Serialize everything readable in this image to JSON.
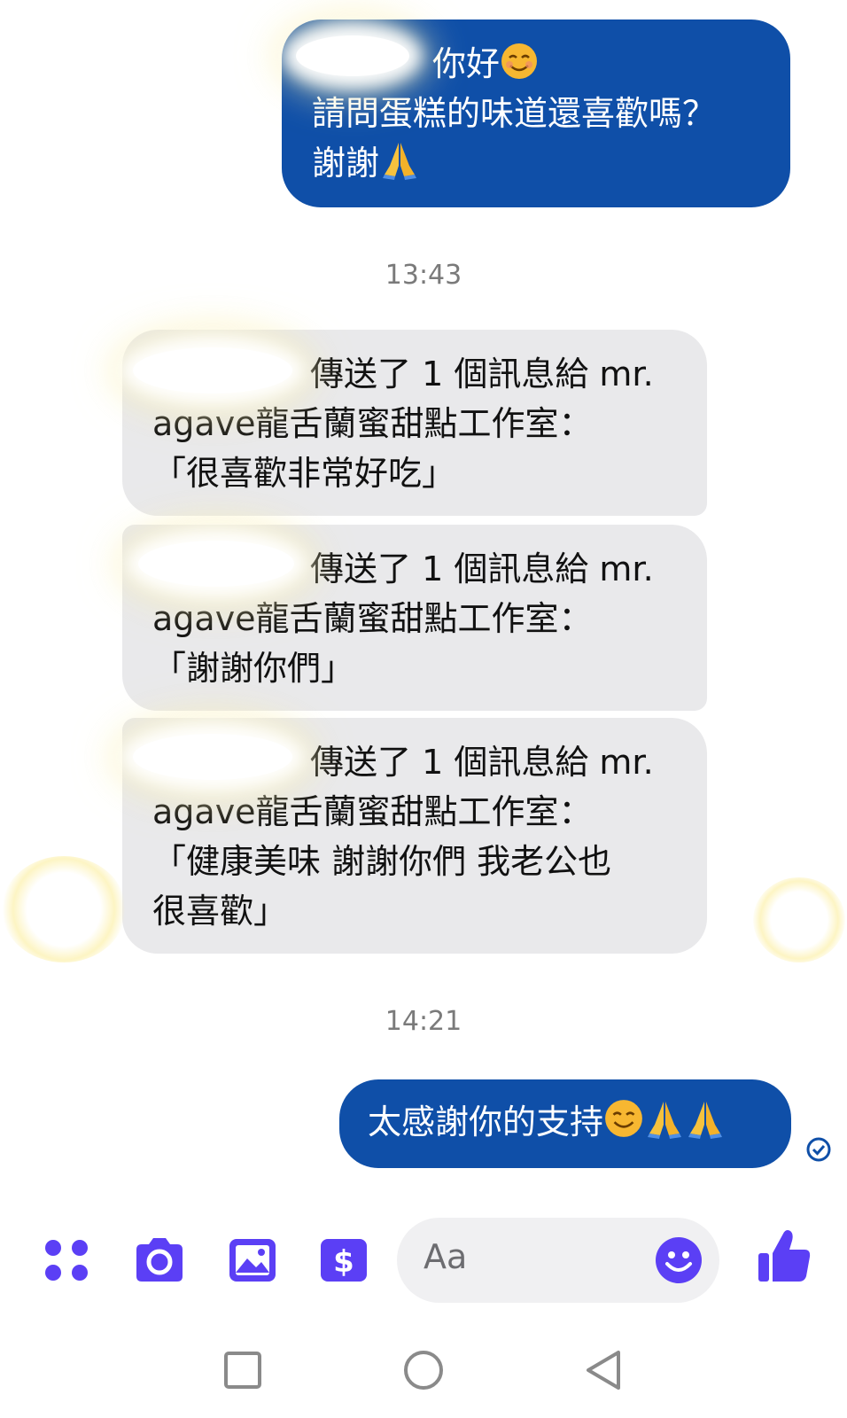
{
  "messages": {
    "out1": {
      "line1": "你好",
      "line2": "請問蛋糕的味道還喜歡嗎？",
      "line3": "謝謝"
    },
    "time1": "13:43",
    "in1": {
      "line1": "傳送了 1 個訊息給 mr.",
      "line2": "agave龍舌蘭蜜甜點工作室：",
      "line3": "「很喜歡非常好吃」"
    },
    "in2": {
      "line1": "傳送了 1 個訊息給 mr.",
      "line2": "agave龍舌蘭蜜甜點工作室：",
      "line3": "「謝謝你們」"
    },
    "in3": {
      "line1": "傳送了 1 個訊息給 mr.",
      "line2": "agave龍舌蘭蜜甜點工作室：",
      "line3": "「健康美味 謝謝你們 我老公也",
      "line4": "很喜歡」"
    },
    "time2": "14:21",
    "out2": {
      "text": "太感謝你的支持"
    }
  },
  "composer": {
    "placeholder": "Aa",
    "icons": [
      "menu-dots-icon",
      "camera-icon",
      "image-icon",
      "payment-icon",
      "emoji-icon",
      "thumbs-up-icon"
    ]
  },
  "navbar": {
    "icons": [
      "recents-icon",
      "home-icon",
      "back-icon"
    ]
  },
  "colors": {
    "outgoing_bubble": "#0f4fa8",
    "incoming_bubble": "#e9e9eb",
    "accent": "#5b3ff5",
    "timestamp": "#7a7a7a"
  }
}
